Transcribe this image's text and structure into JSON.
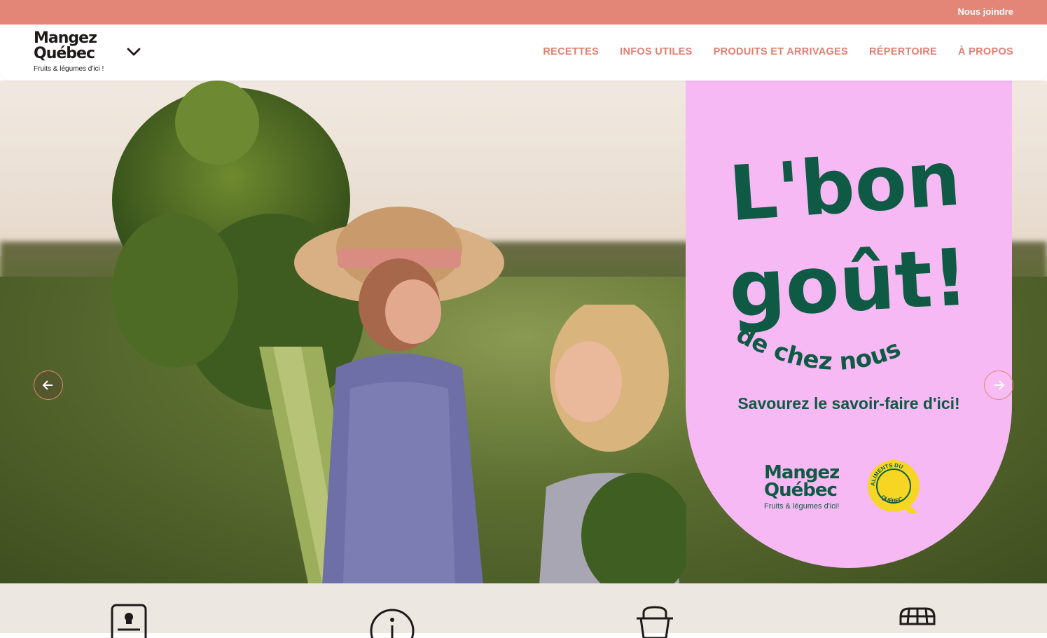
{
  "topbar": {
    "contact_label": "Nous joindre",
    "color": "#e38577"
  },
  "logo": {
    "line1": "Mangez",
    "line2": "Québec",
    "tagline": "Fruits & légumes d'ici !"
  },
  "header": {
    "menu_toggle_icon": "chevron-down-icon"
  },
  "nav": {
    "items": [
      {
        "label": "RECETTES"
      },
      {
        "label": "INFOS UTILES"
      },
      {
        "label": "PRODUITS ET ARRIVAGES"
      },
      {
        "label": "RÉPERTOIRE"
      },
      {
        "label": "À PROPOS"
      }
    ],
    "color": "#e07f72"
  },
  "hero": {
    "promo": {
      "headline_line1": "L'bon",
      "headline_line2": "goût!",
      "arc_text": "de chez nous",
      "slogan": "Savourez le savoir-faire d'ici!",
      "brand_line1": "Mangez",
      "brand_line2": "Québec",
      "brand_tagline": "Fruits & légumes d'ici!",
      "seal_text": "ALIMENTS DU QUÉBEC",
      "background": "#f6b9f3",
      "text_color": "#0e5a44"
    },
    "prev_icon": "arrow-left-icon",
    "next_icon": "arrow-right-icon"
  },
  "categories": {
    "icons": [
      "recipe-card-icon",
      "info-icon",
      "basket-icon",
      "market-stall-icon"
    ]
  }
}
